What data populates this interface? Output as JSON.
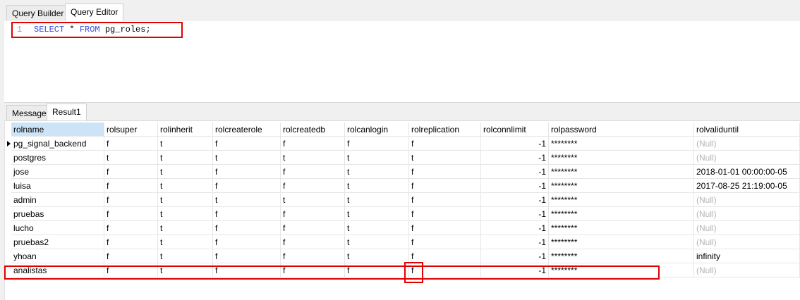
{
  "tabs": {
    "query_builder": "Query Builder",
    "query_editor": "Query Editor"
  },
  "editor": {
    "line_number": "1",
    "kw_select": "SELECT",
    "star": "*",
    "kw_from": "FROM",
    "table": "pg_roles;"
  },
  "result_tabs": {
    "message": "Message",
    "result1": "Result1"
  },
  "columns": [
    "rolname",
    "rolsuper",
    "rolinherit",
    "rolcreaterole",
    "rolcreatedb",
    "rolcanlogin",
    "rolreplication",
    "rolconnlimit",
    "rolpassword",
    "rolvaliduntil"
  ],
  "rows": [
    [
      "pg_signal_backend",
      "f",
      "t",
      "f",
      "f",
      "f",
      "f",
      "-1",
      "********",
      "(Null)"
    ],
    [
      "postgres",
      "t",
      "t",
      "t",
      "t",
      "t",
      "t",
      "-1",
      "********",
      "(Null)"
    ],
    [
      "jose",
      "f",
      "t",
      "f",
      "f",
      "t",
      "f",
      "-1",
      "********",
      "2018-01-01 00:00:00-05"
    ],
    [
      "luisa",
      "f",
      "t",
      "f",
      "f",
      "t",
      "f",
      "-1",
      "********",
      "2017-08-25 21:19:00-05"
    ],
    [
      "admin",
      "f",
      "t",
      "t",
      "t",
      "t",
      "f",
      "-1",
      "********",
      "(Null)"
    ],
    [
      "pruebas",
      "f",
      "t",
      "f",
      "f",
      "t",
      "f",
      "-1",
      "********",
      "(Null)"
    ],
    [
      "lucho",
      "f",
      "t",
      "f",
      "f",
      "t",
      "f",
      "-1",
      "********",
      "(Null)"
    ],
    [
      "pruebas2",
      "f",
      "t",
      "f",
      "f",
      "t",
      "f",
      "-1",
      "********",
      "(Null)"
    ],
    [
      "yhoan",
      "f",
      "t",
      "f",
      "f",
      "t",
      "f",
      "-1",
      "********",
      "infinity"
    ],
    [
      "analistas",
      "f",
      "t",
      "f",
      "f",
      "f",
      "f",
      "-1",
      "********",
      "(Null)"
    ]
  ],
  "colors": {
    "highlight": "#e00000",
    "header_selected": "#cde3f7",
    "null_text": "#b5b5b5",
    "keyword": "#3a4fd6"
  }
}
